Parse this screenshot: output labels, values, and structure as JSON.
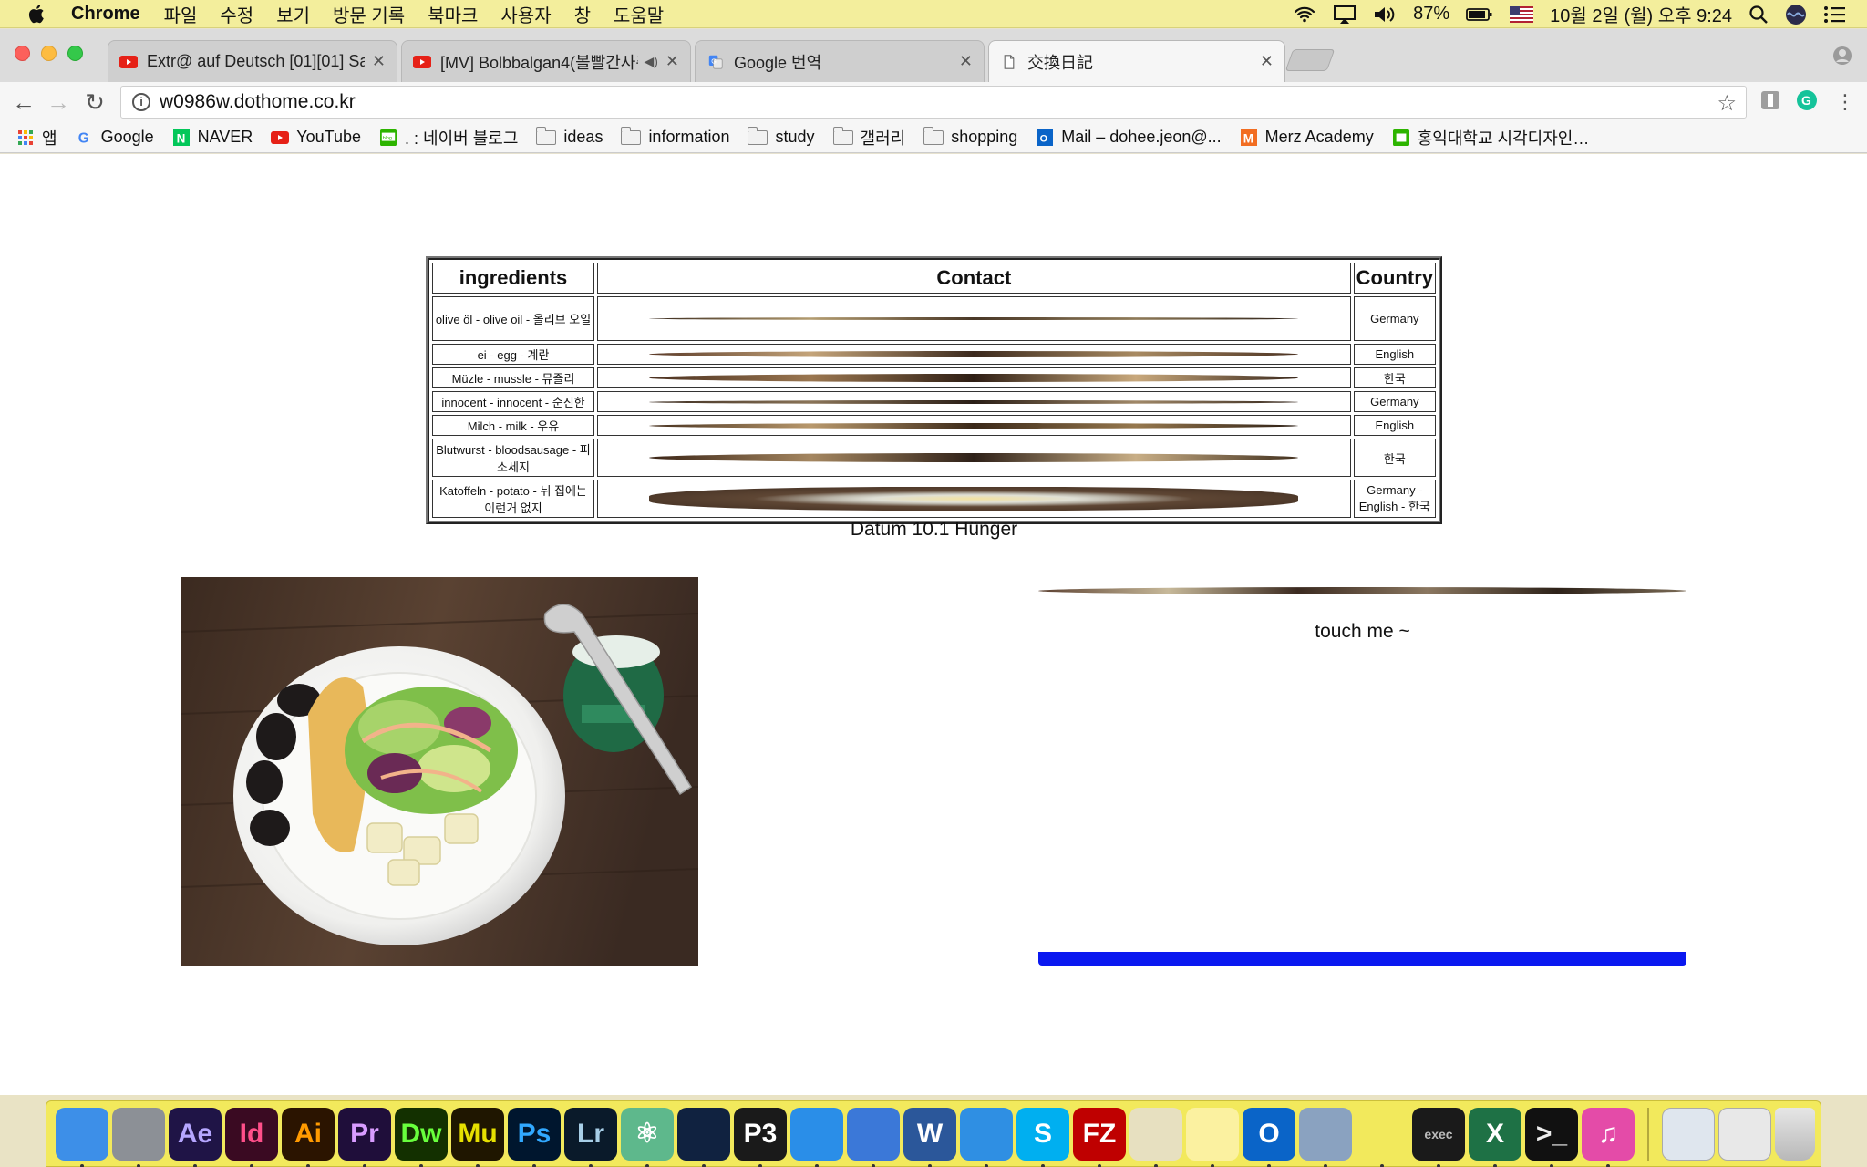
{
  "menubar": {
    "app_name": "Chrome",
    "menus": [
      "파일",
      "수정",
      "보기",
      "방문 기록",
      "북마크",
      "사용자",
      "창",
      "도움말"
    ],
    "battery": "87%",
    "datetime": "10월 2일 (월) 오후 9:24"
  },
  "tabs": [
    {
      "title": "Extr@ auf Deutsch [01][01] Sa",
      "favicon": "youtube-icon"
    },
    {
      "title": "[MV] Bolbbalgan4(볼빨간사춘",
      "favicon": "youtube-icon"
    },
    {
      "title": "Google 번역",
      "favicon": "google-translate-icon"
    },
    {
      "title": "交換日記",
      "favicon": "page-icon",
      "active": true
    }
  ],
  "omnibox": {
    "url": "w0986w.dothome.co.kr"
  },
  "bookmarks": [
    {
      "label": "앱",
      "icon": "apps-grid-icon"
    },
    {
      "label": "Google",
      "icon": "google-icon"
    },
    {
      "label": "NAVER",
      "icon": "naver-icon"
    },
    {
      "label": "YouTube",
      "icon": "youtube-icon"
    },
    {
      "label": ". : 네이버 블로그",
      "icon": "blog-icon"
    },
    {
      "label": "ideas",
      "icon": "folder-icon"
    },
    {
      "label": "information",
      "icon": "folder-icon"
    },
    {
      "label": "study",
      "icon": "folder-icon"
    },
    {
      "label": "갤러리",
      "icon": "folder-icon"
    },
    {
      "label": "shopping",
      "icon": "folder-icon"
    },
    {
      "label": "Mail – dohee.jeon@...",
      "icon": "outlook-icon"
    },
    {
      "label": "Merz Academy",
      "icon": "merz-icon"
    },
    {
      "label": "홍익대학교 시각디자인…",
      "icon": "hongik-icon"
    }
  ],
  "table": {
    "headers": [
      "ingredients",
      "Contact",
      "Country"
    ],
    "rows": [
      {
        "ingredient": "olive öl - olive oil - 올리브 오일",
        "country": "Germany"
      },
      {
        "ingredient": "ei - egg - 계란",
        "country": "English"
      },
      {
        "ingredient": "Müzle - mussle - 뮤즐리",
        "country": "한국"
      },
      {
        "ingredient": "innocent - innocent - 순진한",
        "country": "Germany"
      },
      {
        "ingredient": "Milch - milk - 우유",
        "country": "English"
      },
      {
        "ingredient": "Blutwurst - bloodsausage - 피소세지",
        "country": "한국"
      },
      {
        "ingredient": "Katoffeln - potato - 뉘 집에는 이런거 없지",
        "country": "Germany - English - 한국"
      }
    ]
  },
  "caption": "Datum 10.1 Hünger",
  "touch_label": "touch me ~",
  "dock": {
    "apps": [
      {
        "name": "Finder",
        "label": "",
        "bg": "#3d8fe8",
        "fg": "#fff"
      },
      {
        "name": "Launchpad",
        "label": "",
        "bg": "#8c9096",
        "fg": "#fff"
      },
      {
        "name": "After Effects",
        "label": "Ae",
        "bg": "#1f1446",
        "fg": "#b5a6ff"
      },
      {
        "name": "InDesign",
        "label": "Id",
        "bg": "#3a0a22",
        "fg": "#ff4f8a"
      },
      {
        "name": "Illustrator",
        "label": "Ai",
        "bg": "#2b1400",
        "fg": "#ff9a00"
      },
      {
        "name": "Premiere",
        "label": "Pr",
        "bg": "#1f0e3a",
        "fg": "#d89cff"
      },
      {
        "name": "Dreamweaver",
        "label": "Dw",
        "bg": "#133000",
        "fg": "#68ff3c"
      },
      {
        "name": "Muse",
        "label": "Mu",
        "bg": "#1f1600",
        "fg": "#e6e000"
      },
      {
        "name": "Photoshop",
        "label": "Ps",
        "bg": "#00162e",
        "fg": "#31a8ff"
      },
      {
        "name": "Lightroom",
        "label": "Lr",
        "bg": "#0a1a2a",
        "fg": "#a8cfe8"
      },
      {
        "name": "Atom",
        "label": "⚛",
        "bg": "#5eb88c",
        "fg": "#fff"
      },
      {
        "name": "Cinema 4D",
        "label": "",
        "bg": "#102240",
        "fg": "#fff"
      },
      {
        "name": "Processing",
        "label": "P3",
        "bg": "#1a1a1a",
        "fg": "#fff"
      },
      {
        "name": "Keynote",
        "label": "",
        "bg": "#2a8ee8",
        "fg": "#fff"
      },
      {
        "name": "Dictionary",
        "label": "",
        "bg": "#3b78d8",
        "fg": "#fff"
      },
      {
        "name": "Word",
        "label": "W",
        "bg": "#2b579a",
        "fg": "#fff"
      },
      {
        "name": "Safari",
        "label": "",
        "bg": "#2f8fe3",
        "fg": "#fff"
      },
      {
        "name": "Skype",
        "label": "S",
        "bg": "#00aff0",
        "fg": "#fff"
      },
      {
        "name": "FileZilla",
        "label": "FZ",
        "bg": "#bf0000",
        "fg": "#fff"
      },
      {
        "name": "Chrome",
        "label": "",
        "bg": "#e7e0c0",
        "fg": "#fff"
      },
      {
        "name": "Notes",
        "label": "",
        "bg": "#fbf1a0",
        "fg": "#fff"
      },
      {
        "name": "Outlook",
        "label": "O",
        "bg": "#0a64c8",
        "fg": "#fff"
      },
      {
        "name": "Preview",
        "label": "",
        "bg": "#8aa2c0",
        "fg": "#fff"
      },
      {
        "name": "VLC",
        "label": "",
        "bg": "#f2e95c",
        "fg": "#ff7a00"
      },
      {
        "name": "Exec",
        "label": "exec",
        "bg": "#1a1a1a",
        "fg": "#bbb"
      },
      {
        "name": "Excel",
        "label": "X",
        "bg": "#1e7145",
        "fg": "#fff"
      },
      {
        "name": "Terminal",
        "label": ">_",
        "bg": "#111",
        "fg": "#eee"
      },
      {
        "name": "iTunes",
        "label": "♫",
        "bg": "#e44ba8",
        "fg": "#fff"
      }
    ]
  }
}
